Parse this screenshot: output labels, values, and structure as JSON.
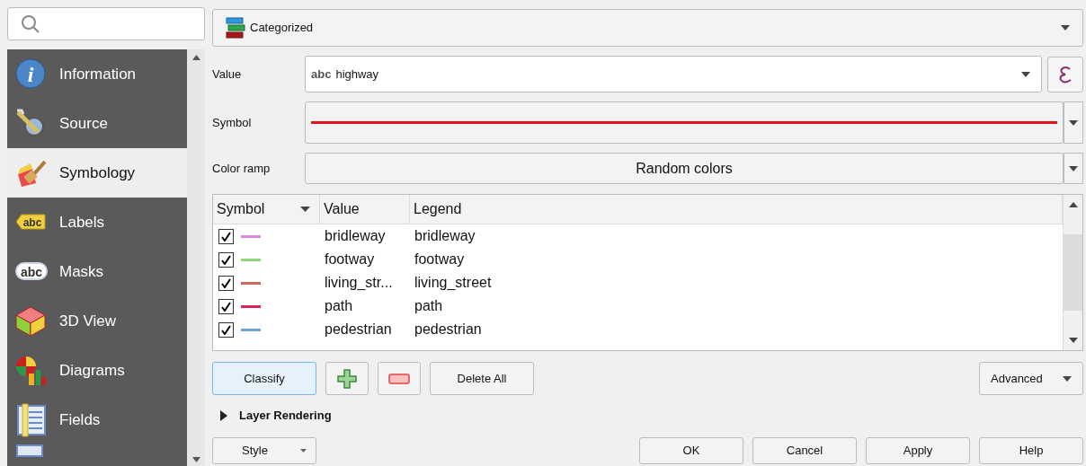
{
  "sidebar": {
    "items": [
      {
        "label": "Information",
        "icon_text": "i",
        "selected": false
      },
      {
        "label": "Source",
        "selected": false
      },
      {
        "label": "Symbology",
        "selected": true
      },
      {
        "label": "Labels",
        "icon_text": "abc",
        "selected": false
      },
      {
        "label": "Masks",
        "icon_text": "abc",
        "selected": false
      },
      {
        "label": "3D View",
        "selected": false
      },
      {
        "label": "Diagrams",
        "selected": false
      },
      {
        "label": "Fields",
        "selected": false
      }
    ]
  },
  "renderer": {
    "value": "Categorized"
  },
  "form": {
    "value_label": "Value",
    "value_type": "abc",
    "value": "highway",
    "symbol_label": "Symbol",
    "ramp_label": "Color ramp",
    "ramp_value": "Random colors"
  },
  "table": {
    "columns": [
      "Symbol",
      "Value",
      "Legend"
    ],
    "rows": [
      {
        "checked": true,
        "color": "#d98ad9",
        "value": "bridleway",
        "legend": "bridleway"
      },
      {
        "checked": true,
        "color": "#8fd67a",
        "value": "footway",
        "legend": "footway"
      },
      {
        "checked": true,
        "color": "#cc6a5c",
        "value": "living_str...",
        "legend": "living_street"
      },
      {
        "checked": true,
        "color": "#d8245a",
        "value": "path",
        "legend": "path"
      },
      {
        "checked": true,
        "color": "#6fa3dc",
        "value": "pedestrian",
        "legend": "pedestrian"
      }
    ]
  },
  "actions": {
    "classify": "Classify",
    "delete_all": "Delete All",
    "advanced": "Advanced"
  },
  "layer_rendering": {
    "label": "Layer Rendering",
    "expanded": false
  },
  "footer": {
    "style": "Style",
    "buttons": [
      "OK",
      "Cancel",
      "Apply",
      "Help"
    ]
  }
}
